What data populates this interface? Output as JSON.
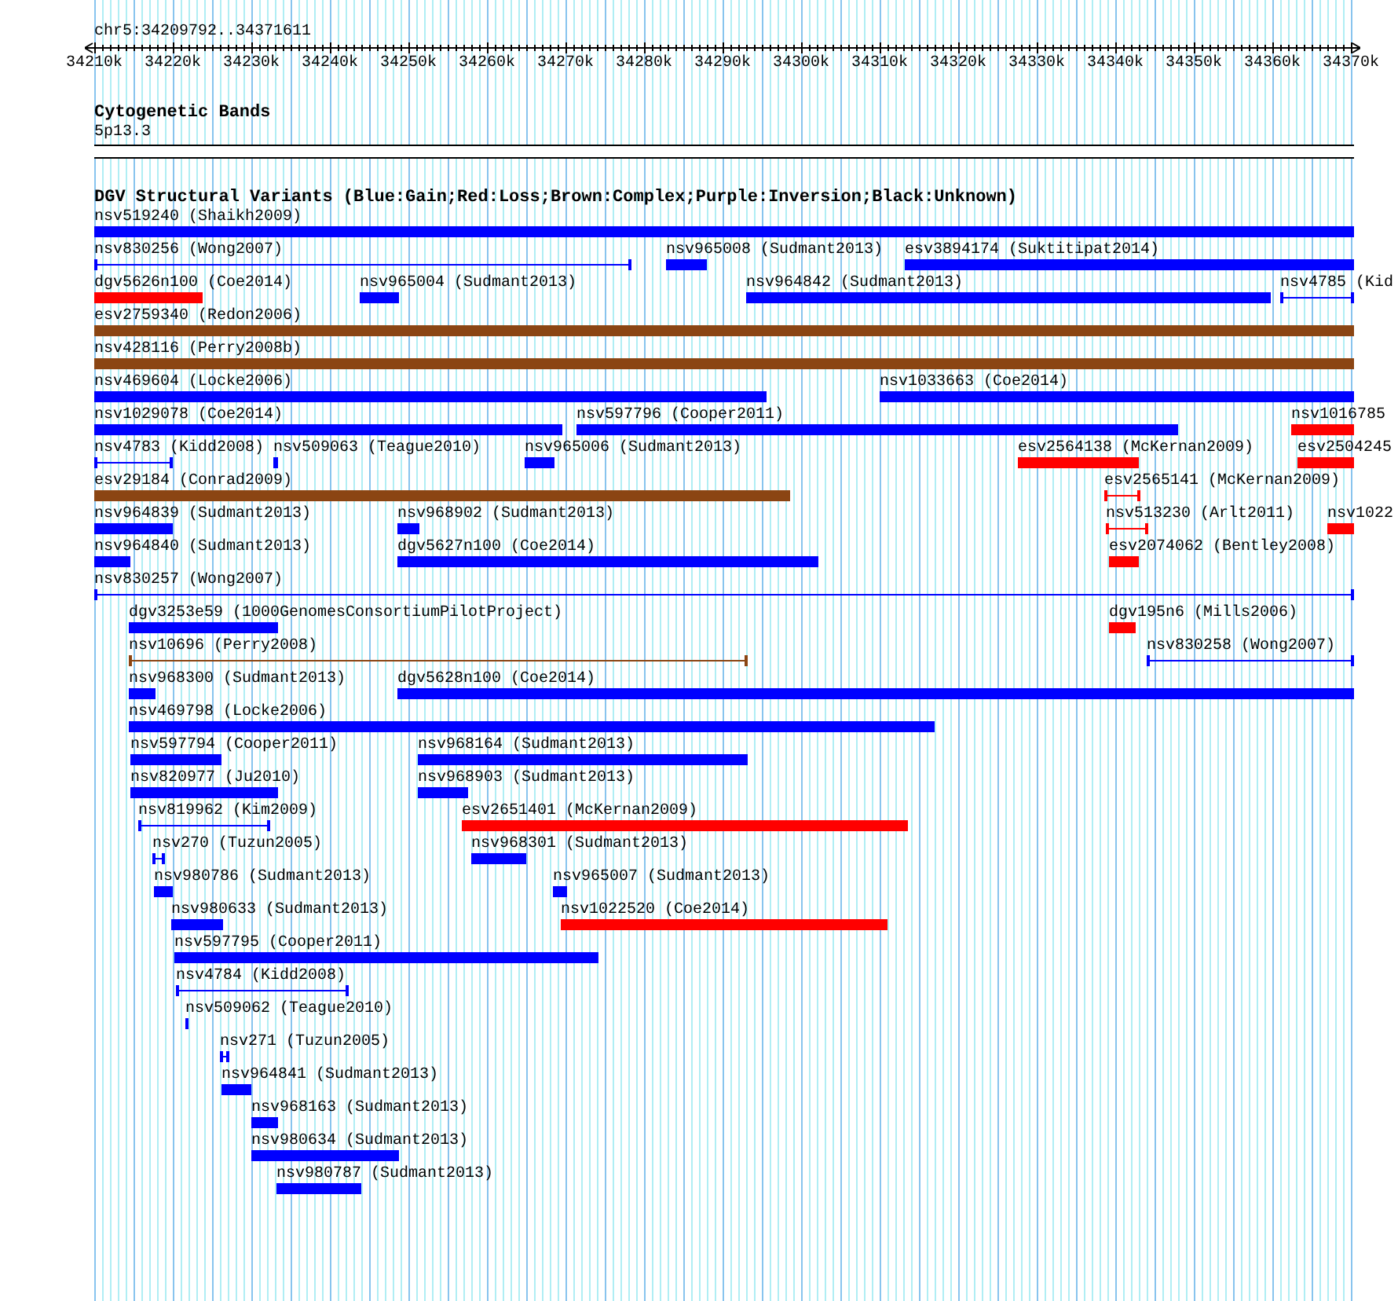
{
  "locus": "chr5:34209792..34371611",
  "ruler": {
    "ticks": [
      "34210k",
      "34220k",
      "34230k",
      "34240k",
      "34250k",
      "34260k",
      "34270k",
      "34280k",
      "34290k",
      "34300k",
      "34310k",
      "34320k",
      "34330k",
      "34340k",
      "34350k",
      "34360k",
      "34370k"
    ]
  },
  "cytogenetic_bands": {
    "title": "Cytogenetic Bands",
    "band": {
      "label": "5p13.3"
    }
  },
  "structural_variants": {
    "title": "DGV Structural Variants (Blue:Gain;Red:Loss;Brown:Complex;Purple:Inversion;Black:Unknown)",
    "rows": [
      {
        "features": [
          {
            "label": "nsv519240 (Shaikh2009)",
            "kind": "bar",
            "color": "#0000ff"
          }
        ]
      },
      {
        "features": [
          {
            "label": "nsv830256 (Wong2007)",
            "kind": "span",
            "color": "#0000ff"
          },
          {
            "label": "nsv965008 (Sudmant2013)",
            "kind": "bar",
            "color": "#0000ff"
          },
          {
            "label": "esv3894174 (Suktitipat2014)",
            "kind": "bar",
            "color": "#0000ff"
          }
        ]
      },
      {
        "features": [
          {
            "label": "dgv5626n100 (Coe2014)",
            "kind": "bar",
            "color": "#ff0000"
          },
          {
            "label": "nsv965004 (Sudmant2013)",
            "kind": "bar",
            "color": "#0000ff"
          },
          {
            "label": "nsv964842 (Sudmant2013)",
            "kind": "bar",
            "color": "#0000ff"
          },
          {
            "label": "nsv4785 (Kid",
            "kind": "span",
            "color": "#0000ff"
          }
        ]
      },
      {
        "features": [
          {
            "label": "esv2759340 (Redon2006)",
            "kind": "bar",
            "color": "#8b4513"
          }
        ]
      },
      {
        "features": [
          {
            "label": "nsv428116 (Perry2008b)",
            "kind": "bar",
            "color": "#8b4513"
          }
        ]
      },
      {
        "features": [
          {
            "label": "nsv469604 (Locke2006)",
            "kind": "bar",
            "color": "#0000ff"
          },
          {
            "label": "nsv1033663 (Coe2014)",
            "kind": "bar",
            "color": "#0000ff"
          }
        ]
      },
      {
        "features": [
          {
            "label": "nsv1029078 (Coe2014)",
            "kind": "bar",
            "color": "#0000ff"
          },
          {
            "label": "nsv597796 (Cooper2011)",
            "kind": "bar",
            "color": "#0000ff"
          },
          {
            "label": "nsv1016785",
            "kind": "bar",
            "color": "#ff0000"
          }
        ]
      },
      {
        "features": [
          {
            "label": "nsv4783 (Kidd2008)",
            "kind": "span",
            "color": "#0000ff"
          },
          {
            "label": "nsv509063 (Teague2010)",
            "kind": "bar",
            "color": "#0000ff"
          },
          {
            "label": "nsv965006 (Sudmant2013)",
            "kind": "bar",
            "color": "#0000ff"
          },
          {
            "label": "esv2564138 (McKernan2009)",
            "kind": "bar",
            "color": "#ff0000"
          },
          {
            "label": "esv2504245",
            "kind": "bar",
            "color": "#ff0000"
          }
        ]
      },
      {
        "features": [
          {
            "label": "esv29184 (Conrad2009)",
            "kind": "bar",
            "color": "#8b4513"
          },
          {
            "label": "esv2565141 (McKernan2009)",
            "kind": "span",
            "color": "#ff0000"
          }
        ]
      },
      {
        "features": [
          {
            "label": "nsv964839 (Sudmant2013)",
            "kind": "bar",
            "color": "#0000ff"
          },
          {
            "label": "nsv968902 (Sudmant2013)",
            "kind": "bar",
            "color": "#0000ff"
          },
          {
            "label": "nsv513230 (Arlt2011)",
            "kind": "span",
            "color": "#ff0000"
          },
          {
            "label": "nsv1022",
            "kind": "bar",
            "color": "#ff0000"
          }
        ]
      },
      {
        "features": [
          {
            "label": "nsv964840 (Sudmant2013)",
            "kind": "bar",
            "color": "#0000ff"
          },
          {
            "label": "dgv5627n100 (Coe2014)",
            "kind": "bar",
            "color": "#0000ff"
          },
          {
            "label": "esv2074062 (Bentley2008)",
            "kind": "bar",
            "color": "#ff0000"
          }
        ]
      },
      {
        "features": [
          {
            "label": "nsv830257 (Wong2007)",
            "kind": "span",
            "color": "#0000ff"
          }
        ]
      },
      {
        "features": [
          {
            "label": "dgv3253e59 (1000GenomesConsortiumPilotProject)",
            "kind": "bar",
            "color": "#0000ff"
          },
          {
            "label": "dgv195n6 (Mills2006)",
            "kind": "bar",
            "color": "#ff0000"
          }
        ]
      },
      {
        "features": [
          {
            "label": "nsv10696 (Perry2008)",
            "kind": "span",
            "color": "#8b4513"
          },
          {
            "label": "nsv830258 (Wong2007)",
            "kind": "span",
            "color": "#0000ff"
          }
        ]
      },
      {
        "features": [
          {
            "label": "nsv968300 (Sudmant2013)",
            "kind": "bar",
            "color": "#0000ff"
          },
          {
            "label": "dgv5628n100 (Coe2014)",
            "kind": "bar",
            "color": "#0000ff"
          }
        ]
      },
      {
        "features": [
          {
            "label": "nsv469798 (Locke2006)",
            "kind": "bar",
            "color": "#0000ff"
          }
        ]
      },
      {
        "features": [
          {
            "label": "nsv597794 (Cooper2011)",
            "kind": "bar",
            "color": "#0000ff"
          },
          {
            "label": "nsv968164 (Sudmant2013)",
            "kind": "bar",
            "color": "#0000ff"
          }
        ]
      },
      {
        "features": [
          {
            "label": "nsv820977 (Ju2010)",
            "kind": "bar",
            "color": "#0000ff"
          },
          {
            "label": "nsv968903 (Sudmant2013)",
            "kind": "bar",
            "color": "#0000ff"
          }
        ]
      },
      {
        "features": [
          {
            "label": "nsv819962 (Kim2009)",
            "kind": "span",
            "color": "#0000ff"
          },
          {
            "label": "esv2651401 (McKernan2009)",
            "kind": "bar",
            "color": "#ff0000"
          }
        ]
      },
      {
        "features": [
          {
            "label": "nsv270 (Tuzun2005)",
            "kind": "span",
            "color": "#0000ff"
          },
          {
            "label": "nsv968301 (Sudmant2013)",
            "kind": "bar",
            "color": "#0000ff"
          }
        ]
      },
      {
        "features": [
          {
            "label": "nsv980786 (Sudmant2013)",
            "kind": "bar",
            "color": "#0000ff"
          },
          {
            "label": "nsv965007 (Sudmant2013)",
            "kind": "bar",
            "color": "#0000ff"
          }
        ]
      },
      {
        "features": [
          {
            "label": "nsv980633 (Sudmant2013)",
            "kind": "bar",
            "color": "#0000ff"
          },
          {
            "label": "nsv1022520 (Coe2014)",
            "kind": "bar",
            "color": "#ff0000"
          }
        ]
      },
      {
        "features": [
          {
            "label": "nsv597795 (Cooper2011)",
            "kind": "bar",
            "color": "#0000ff"
          }
        ]
      },
      {
        "features": [
          {
            "label": "nsv4784 (Kidd2008)",
            "kind": "span",
            "color": "#0000ff"
          }
        ]
      },
      {
        "features": [
          {
            "label": "nsv509062 (Teague2010)",
            "kind": "bar",
            "color": "#0000ff"
          }
        ]
      },
      {
        "features": [
          {
            "label": "nsv271 (Tuzun2005)",
            "kind": "span",
            "color": "#0000ff"
          }
        ]
      },
      {
        "features": [
          {
            "label": "nsv964841 (Sudmant2013)",
            "kind": "bar",
            "color": "#0000ff"
          }
        ]
      },
      {
        "features": [
          {
            "label": "nsv968163 (Sudmant2013)",
            "kind": "bar",
            "color": "#0000ff"
          }
        ]
      },
      {
        "features": [
          {
            "label": "nsv980634 (Sudmant2013)",
            "kind": "bar",
            "color": "#0000ff"
          }
        ]
      },
      {
        "features": [
          {
            "label": "nsv980787 (Sudmant2013)",
            "kind": "bar",
            "color": "#0000ff"
          }
        ]
      }
    ]
  }
}
